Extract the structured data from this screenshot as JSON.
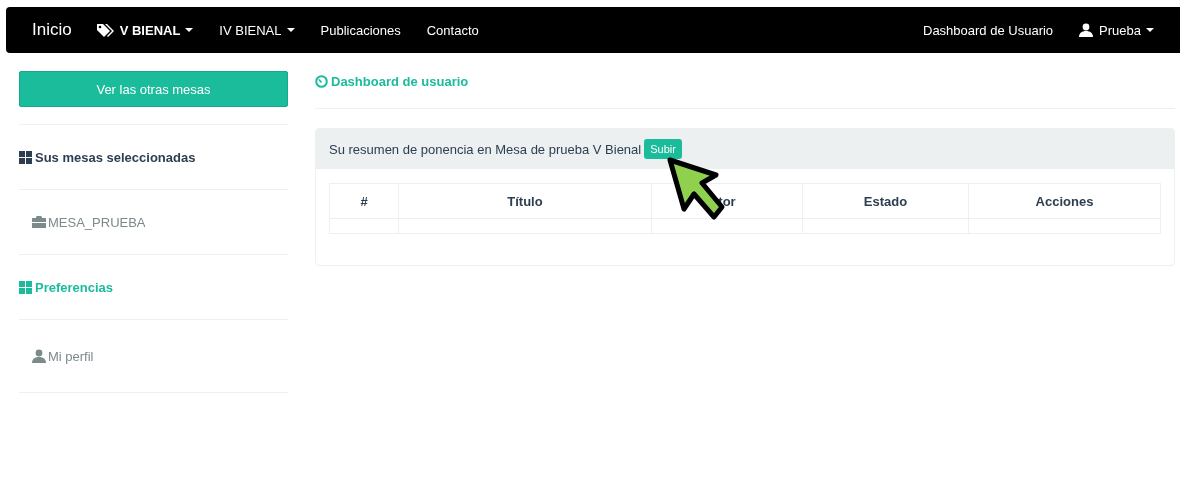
{
  "navbar": {
    "brand": "Inicio",
    "items": [
      {
        "label": "V BIENAL",
        "dropdown": true,
        "selected": true
      },
      {
        "label": "IV BIENAL",
        "dropdown": true,
        "selected": false
      },
      {
        "label": "Publicaciones",
        "dropdown": false,
        "selected": false
      },
      {
        "label": "Contacto",
        "dropdown": false,
        "selected": false
      }
    ],
    "right": [
      {
        "label": "Dashboard de Usuario",
        "dropdown": false
      },
      {
        "label": "Prueba",
        "dropdown": true
      }
    ]
  },
  "sidebar": {
    "items": [
      {
        "kind": "button",
        "label": "Ver las otras mesas"
      },
      {
        "kind": "header",
        "label": "Sus mesas seleccionadas",
        "selected": false
      },
      {
        "kind": "link",
        "label": "MESA_PRUEBA"
      },
      {
        "kind": "header",
        "label": "Preferencias",
        "selected": true
      },
      {
        "kind": "link",
        "label": "Mi perfil"
      }
    ]
  },
  "page_title": "Dashboard de usuario",
  "panel": {
    "heading": "Su resumen de ponencia en Mesa de prueba V Bienal",
    "button": "Subir",
    "table": {
      "columns": [
        "#",
        "Título",
        "tor",
        "Estado",
        "Acciones"
      ]
    }
  }
}
